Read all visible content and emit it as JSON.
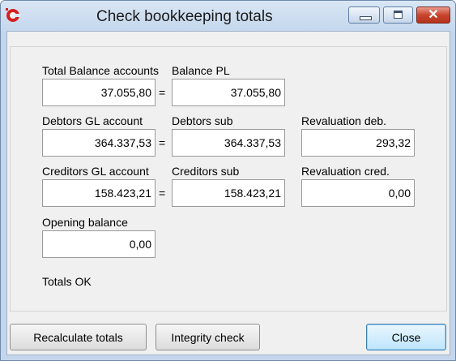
{
  "window": {
    "title": "Check bookkeeping totals",
    "icon": "app-logo-icon"
  },
  "fields": {
    "total_balance": {
      "label": "Total Balance accounts",
      "value": "37.055,80"
    },
    "balance_pl": {
      "label": "Balance PL",
      "value": "37.055,80"
    },
    "debtors_gl": {
      "label": "Debtors GL account",
      "value": "364.337,53"
    },
    "debtors_sub": {
      "label": "Debtors sub",
      "value": "364.337,53"
    },
    "revaluation_deb": {
      "label": "Revaluation deb.",
      "value": "293,32"
    },
    "creditors_gl": {
      "label": "Creditors GL account",
      "value": "158.423,21"
    },
    "creditors_sub": {
      "label": "Creditors sub",
      "value": "158.423,21"
    },
    "revaluation_cred": {
      "label": "Revaluation cred.",
      "value": "0,00"
    },
    "opening_balance": {
      "label": "Opening balance",
      "value": "0,00"
    }
  },
  "equals_sign": "=",
  "status": "Totals OK",
  "buttons": {
    "recalculate": "Recalculate totals",
    "integrity": "Integrity check",
    "close": "Close"
  }
}
